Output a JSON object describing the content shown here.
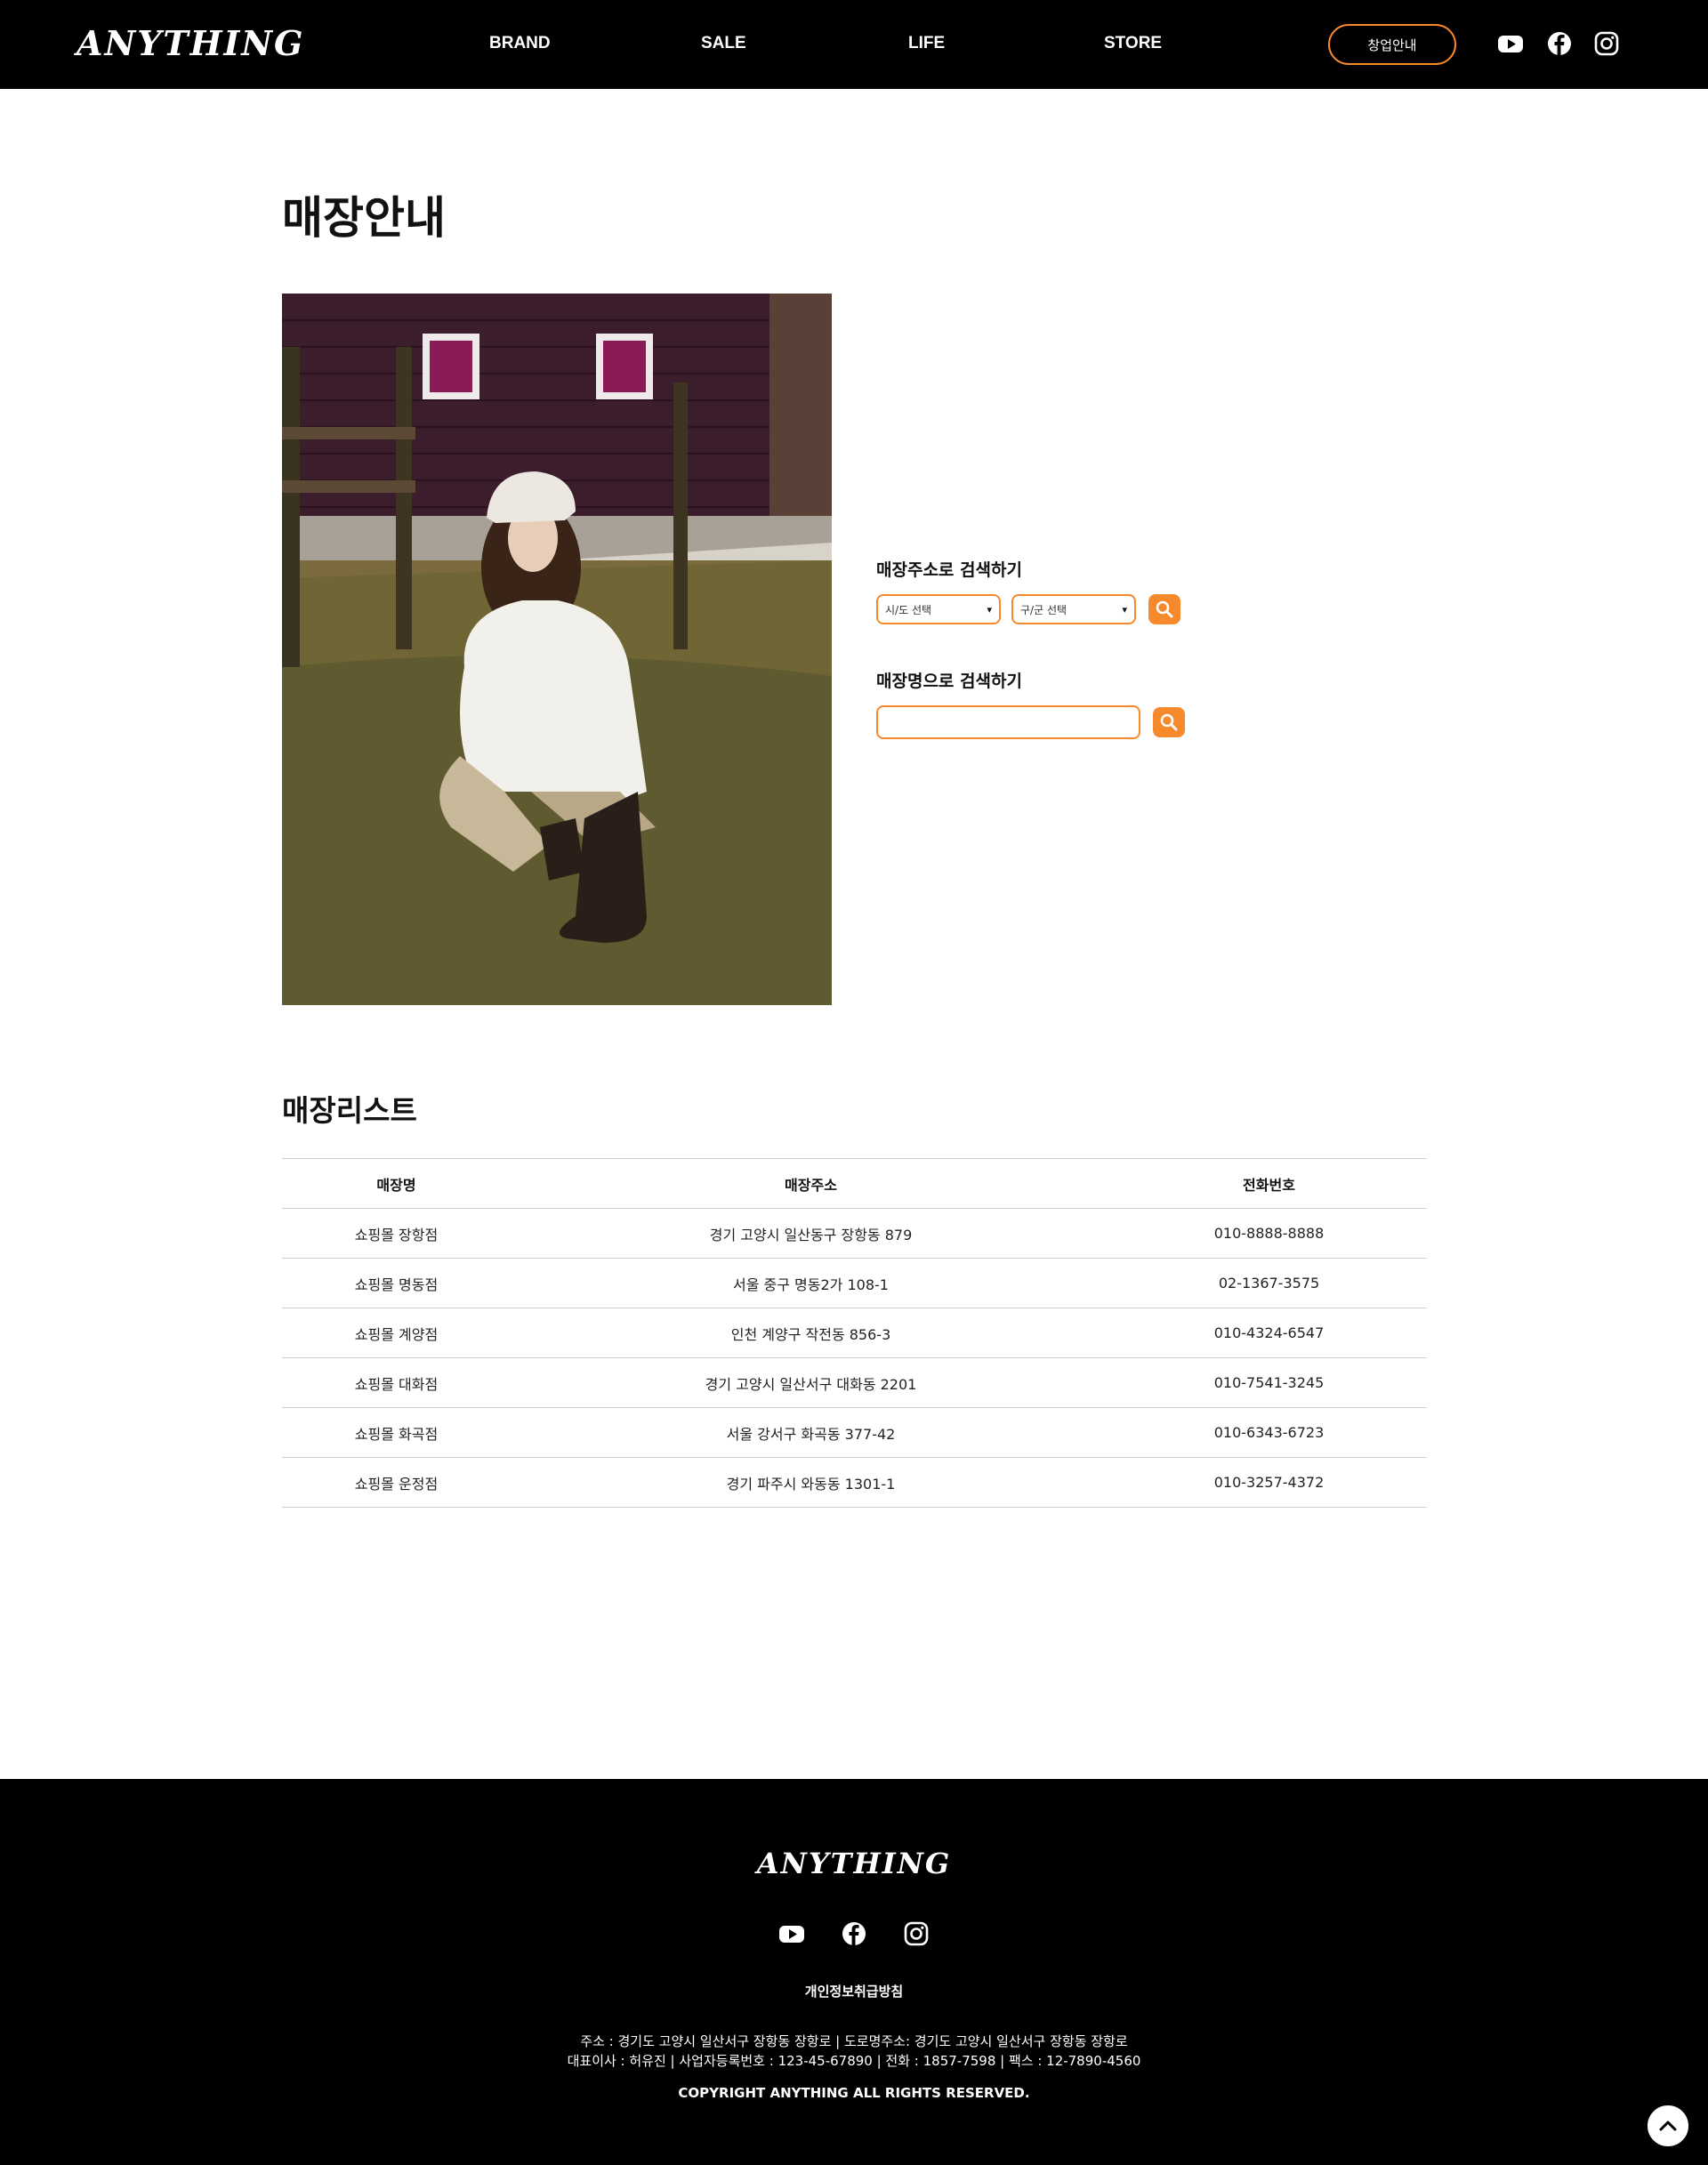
{
  "header": {
    "logo": "ANYTHING",
    "nav": [
      "BRAND",
      "SALE",
      "LIFE",
      "STORE"
    ],
    "cta": "창업안내",
    "social": [
      "youtube-icon",
      "facebook-icon",
      "instagram-icon"
    ]
  },
  "page": {
    "title": "매장안내"
  },
  "search": {
    "address_label": "매장주소로 검색하기",
    "city_select": "시/도 선택",
    "district_select": "구/군 선택",
    "name_label": "매장명으로 검색하기",
    "name_value": ""
  },
  "store_list": {
    "title": "매장리스트",
    "headers": [
      "매장명",
      "매장주소",
      "전화번호"
    ],
    "rows": [
      [
        "쇼핑몰 장항점",
        "경기 고양시 일산동구 장항동 879",
        "010-8888-8888"
      ],
      [
        "쇼핑몰 명동점",
        "서울 중구 명동2가 108-1",
        "02-1367-3575"
      ],
      [
        "쇼핑몰 계양점",
        "인천 계양구 작전동 856-3",
        "010-4324-6547"
      ],
      [
        "쇼핑몰 대화점",
        "경기 고양시 일산서구 대화동 2201",
        "010-7541-3245"
      ],
      [
        "쇼핑몰 화곡점",
        "서울 강서구 화곡동 377-42",
        "010-6343-6723"
      ],
      [
        "쇼핑몰 운정점",
        "경기 파주시 와동동 1301-1",
        "010-3257-4372"
      ]
    ]
  },
  "footer": {
    "logo": "ANYTHING",
    "privacy": "개인정보취급방침",
    "info_line1": "주소 : 경기도 고양시 일산서구 장항동 장항로 | 도로명주소: 경기도 고양시 일산서구 장항동 장항로",
    "info_line2": "대표이사 : 허유진 | 사업자등록번호 : 123-45-67890 | 전화 : 1857-7598 | 팩스 : 12-7890-4560",
    "copyright": "COPYRIGHT ANYTHING ALL RIGHTS RESERVED."
  },
  "colors": {
    "accent": "#f5892b",
    "header_bg": "#000000"
  }
}
